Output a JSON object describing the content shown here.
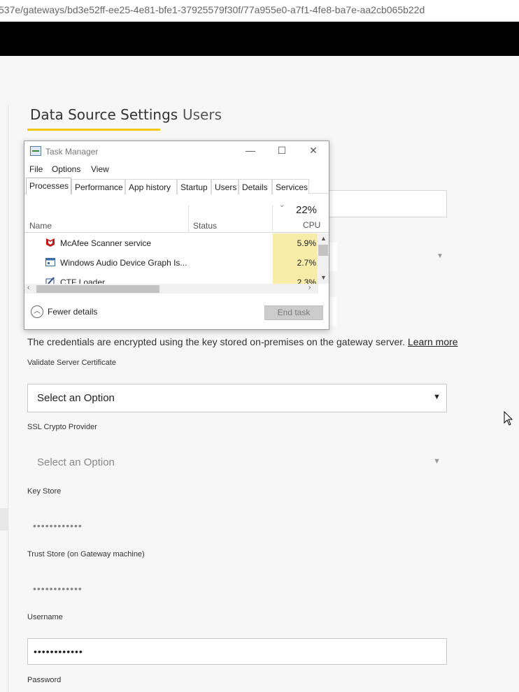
{
  "browser": {
    "url": "537e/gateways/bd3e52ff-ee25-4e81-bfe1-37925579f30f/77a955e0-a7f1-4fe8-ba7e-aa2cb065b22d"
  },
  "tabs": {
    "data_source_settings": "Data Source Settings",
    "users": "Users"
  },
  "form": {
    "info_text": "The credentials are encrypted using the key stored on-premises on the gateway server.",
    "learn_more": "Learn more",
    "validate_cert_label": "Validate Server Certificate",
    "validate_cert_value": "Select an Option",
    "ssl_provider_label": "SSL Crypto Provider",
    "ssl_provider_value": "Select an Option",
    "key_store_label": "Key Store",
    "key_store_value": "••••••••••••",
    "trust_store_label": "Trust Store (on Gateway machine)",
    "trust_store_value": "••••••••••••",
    "username_label": "Username",
    "username_value": "••••••••••••",
    "password_label": "Password"
  },
  "task_manager": {
    "title": "Task Manager",
    "menu": [
      "File",
      "Options",
      "View"
    ],
    "tabs": [
      "Processes",
      "Performance",
      "App history",
      "Startup",
      "Users",
      "Details",
      "Services"
    ],
    "selected_tab": "Processes",
    "columns": {
      "name": "Name",
      "status": "Status",
      "cpu": "CPU"
    },
    "cpu_total": "22%",
    "processes": [
      {
        "name": "McAfee Scanner service",
        "cpu": "5.9%",
        "icon": "mcafee-icon"
      },
      {
        "name": "Windows Audio Device Graph Is...",
        "cpu": "2.7%",
        "icon": "app-window-icon"
      },
      {
        "name": "CTF Loader",
        "cpu": "2.3%",
        "icon": "ctf-loader-icon"
      }
    ],
    "fewer_details": "Fewer details",
    "end_task": "End task"
  },
  "colors": {
    "accent_underline": "#f2c811",
    "cpu_highlight": "#f9eca8"
  }
}
